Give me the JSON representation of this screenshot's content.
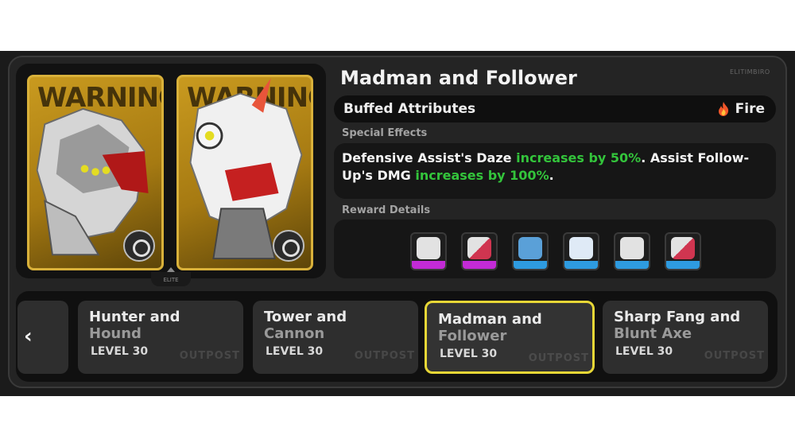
{
  "boss": {
    "title": "Madman and Follower",
    "brand": "ELITIMBIRO"
  },
  "cards": [
    {
      "warning": "WARNING",
      "icon": "creature-silhouette-icon"
    },
    {
      "warning": "WARNING",
      "icon": "creature-silhouette-icon"
    }
  ],
  "elite_tab": "ELITE",
  "buffed": {
    "label": "Buffed Attributes",
    "element": "Fire",
    "element_icon": "fire-icon"
  },
  "special_effects": {
    "label": "Special Effects",
    "p1": "Defensive Assist's Daze ",
    "h1": "increases by 50%",
    "p2": ". Assist Follow-Up's DMG ",
    "h2": "increases by 100%",
    "p3": "."
  },
  "reward": {
    "label": "Reward Details",
    "items": [
      {
        "icon": "reward-disk-icon",
        "rarity_color": "#c32bd6"
      },
      {
        "icon": "reward-disk-icon",
        "rarity_color": "#c32bd6"
      },
      {
        "icon": "reward-canister-icon",
        "rarity_color": "#2e9be0"
      },
      {
        "icon": "reward-star-icon",
        "rarity_color": "#2e9be0"
      },
      {
        "icon": "reward-disk-icon",
        "rarity_color": "#2e9be0"
      },
      {
        "icon": "reward-disk-icon",
        "rarity_color": "#2e9be0"
      }
    ]
  },
  "selector": {
    "prev_glyph": "‹",
    "items": [
      {
        "line1": "Hunter and",
        "line2": "Hound",
        "level": "LEVEL 30",
        "watermark": "OUTPOST"
      },
      {
        "line1": "Tower and",
        "line2": "Cannon",
        "level": "LEVEL 30",
        "watermark": "OUTPOST"
      },
      {
        "line1": "Madman and",
        "line2": "Follower",
        "level": "LEVEL 30",
        "watermark": "OUTPOST",
        "active": true
      },
      {
        "line1": "Sharp Fang and",
        "line2": "Blunt Axe",
        "level": "LEVEL 30",
        "watermark": "OUTPOST"
      }
    ]
  },
  "colors": {
    "accent_yellow": "#e7d736",
    "highlight_green": "#33c43b",
    "card_gold": "#d9b13a"
  }
}
